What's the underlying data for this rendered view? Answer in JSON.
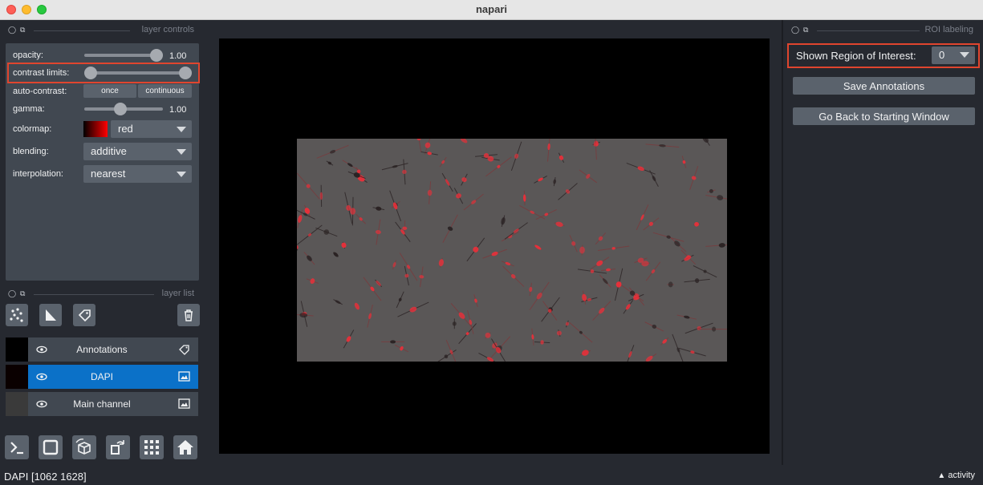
{
  "window": {
    "title": "napari"
  },
  "layer_controls": {
    "dock_title": "layer controls",
    "opacity": {
      "label": "opacity:",
      "value": "1.00",
      "level": 1.0
    },
    "contrast_limits": {
      "label": "contrast limits:",
      "low": 0.0,
      "high": 1.0
    },
    "auto_contrast": {
      "label": "auto-contrast:",
      "once": "once",
      "continuous": "continuous"
    },
    "gamma": {
      "label": "gamma:",
      "value": "1.00",
      "level": 0.45
    },
    "colormap": {
      "label": "colormap:",
      "value": "red"
    },
    "blending": {
      "label": "blending:",
      "value": "additive"
    },
    "interpolation": {
      "label": "interpolation:",
      "value": "nearest"
    }
  },
  "layer_list": {
    "dock_title": "layer list",
    "layers": [
      {
        "name": "Annotations",
        "type_icon": "label-tag-icon",
        "selected": false
      },
      {
        "name": "DAPI",
        "type_icon": "image-icon",
        "selected": true
      },
      {
        "name": "Main channel",
        "type_icon": "image-icon",
        "selected": false
      }
    ]
  },
  "roi": {
    "dock_title": "ROI labeling",
    "shown_label": "Shown Region of Interest:",
    "shown_value": "0",
    "save_button": "Save Annotations",
    "back_button": "Go Back to Starting Window"
  },
  "status": {
    "text": "DAPI [1062 1628]",
    "activity": "activity"
  },
  "colors": {
    "background": "#262930",
    "panel": "#414851",
    "control": "#5a626c",
    "selection": "#0b71c8",
    "highlight_box": "#e0452e",
    "cell_red": "#e8303a"
  }
}
